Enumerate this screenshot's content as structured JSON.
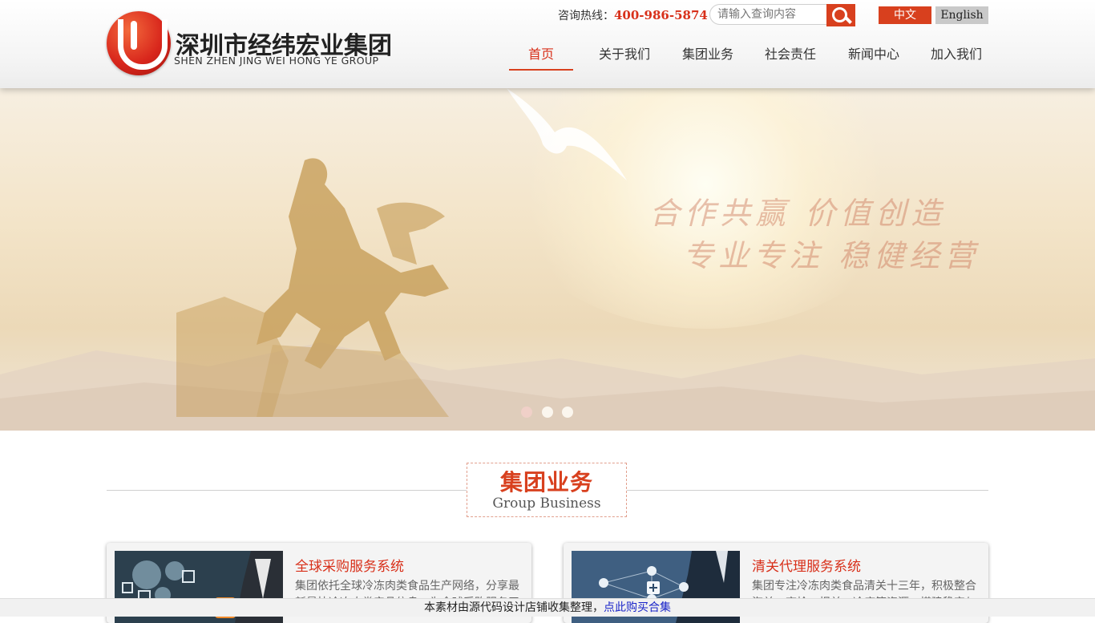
{
  "brand": {
    "name_cn": "深圳市经纬宏业集团",
    "name_en": "SHEN ZHEN JING WEI HONG YE GROUP"
  },
  "header": {
    "hotline_label": "咨询热线：",
    "hotline_number": "400-986-5874",
    "search_placeholder": "请输入查询内容",
    "lang_cn": "中文",
    "lang_en": "English"
  },
  "nav": {
    "items": [
      {
        "label": "首页",
        "active": true
      },
      {
        "label": "关于我们"
      },
      {
        "label": "集团业务"
      },
      {
        "label": "社会责任"
      },
      {
        "label": "新闻中心"
      },
      {
        "label": "加入我们"
      }
    ]
  },
  "banner": {
    "slogan_line1": "合作共赢 价值创造",
    "slogan_line2": "专业专注 稳健经营",
    "slides": 3,
    "active_slide": 1
  },
  "section": {
    "title_cn": "集团业务",
    "title_en": "Group Business"
  },
  "cards": [
    {
      "title": "全球采购服务系统",
      "desc": "集团依托全球冷冻肉类食品生产网络，分享最新最快冷冻肉类产品信息，为全球采购服务平"
    },
    {
      "title": "清关代理服务系统",
      "desc": "集团专注冷冻肉类食品清关十三年，积极整合海关、商检、报关、冷库等资源，搭建稳定与"
    }
  ],
  "footer": {
    "text": "本素材由源代码设计店铺收集整理，",
    "link": "点此购买合集"
  },
  "colors": {
    "accent": "#d8401e",
    "accent_text": "#d8301a",
    "lang_inactive": "#c9c9c9",
    "link": "#1a25c9"
  }
}
